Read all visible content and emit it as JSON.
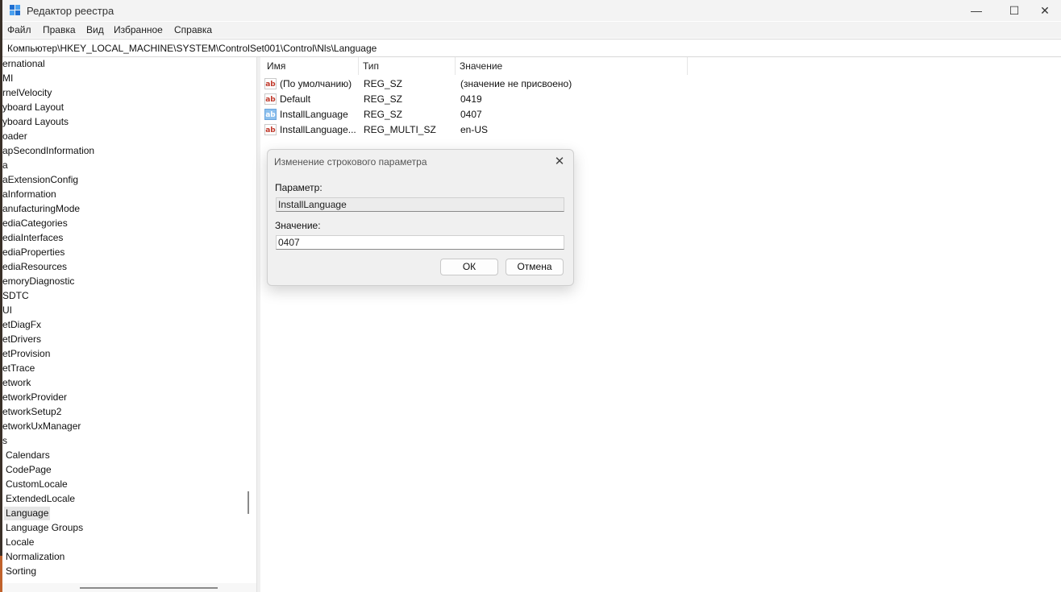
{
  "window": {
    "title": "Редактор реестра",
    "controls": {
      "minimize": "—",
      "maximize": "☐",
      "close": "✕"
    }
  },
  "menu": [
    "Файл",
    "Правка",
    "Вид",
    "Избранное",
    "Справка"
  ],
  "address": "Компьютер\\HKEY_LOCAL_MACHINE\\SYSTEM\\ControlSet001\\Control\\Nls\\Language",
  "tree": {
    "items": [
      "ernational",
      "MI",
      "rnelVelocity",
      "yboard Layout",
      "yboard Layouts",
      "oader",
      "apSecondInformation",
      "a",
      "aExtensionConfig",
      "aInformation",
      "anufacturingMode",
      "ediaCategories",
      "ediaInterfaces",
      "ediaProperties",
      "ediaResources",
      "emoryDiagnostic",
      "SDTC",
      "UI",
      "etDiagFx",
      "etDrivers",
      "etProvision",
      "etTrace",
      "etwork",
      "etworkProvider",
      "etworkSetup2",
      "etworkUxManager",
      "s",
      "Calendars",
      "CodePage",
      "CustomLocale",
      "ExtendedLocale",
      "Language",
      "Language Groups",
      "Locale",
      "Normalization",
      "Sorting"
    ],
    "selected": "Language"
  },
  "list": {
    "columns": {
      "name": "Имя",
      "type": "Тип",
      "value": "Значение"
    },
    "rows": [
      {
        "name": "(По умолчанию)",
        "type": "REG_SZ",
        "value": "(значение не присвоено)",
        "icon": "string-value-icon"
      },
      {
        "name": "Default",
        "type": "REG_SZ",
        "value": "0419",
        "icon": "string-value-icon"
      },
      {
        "name": "InstallLanguage",
        "type": "REG_SZ",
        "value": "0407",
        "icon": "string-value-icon"
      },
      {
        "name": "InstallLanguage...",
        "type": "REG_MULTI_SZ",
        "value": "en-US",
        "icon": "string-value-icon"
      }
    ]
  },
  "dialog": {
    "title": "Изменение строкового параметра",
    "param_label": "Параметр:",
    "param_value": "InstallLanguage",
    "value_label": "Значение:",
    "value_value": "0407",
    "ok": "ОК",
    "cancel": "Отмена"
  }
}
